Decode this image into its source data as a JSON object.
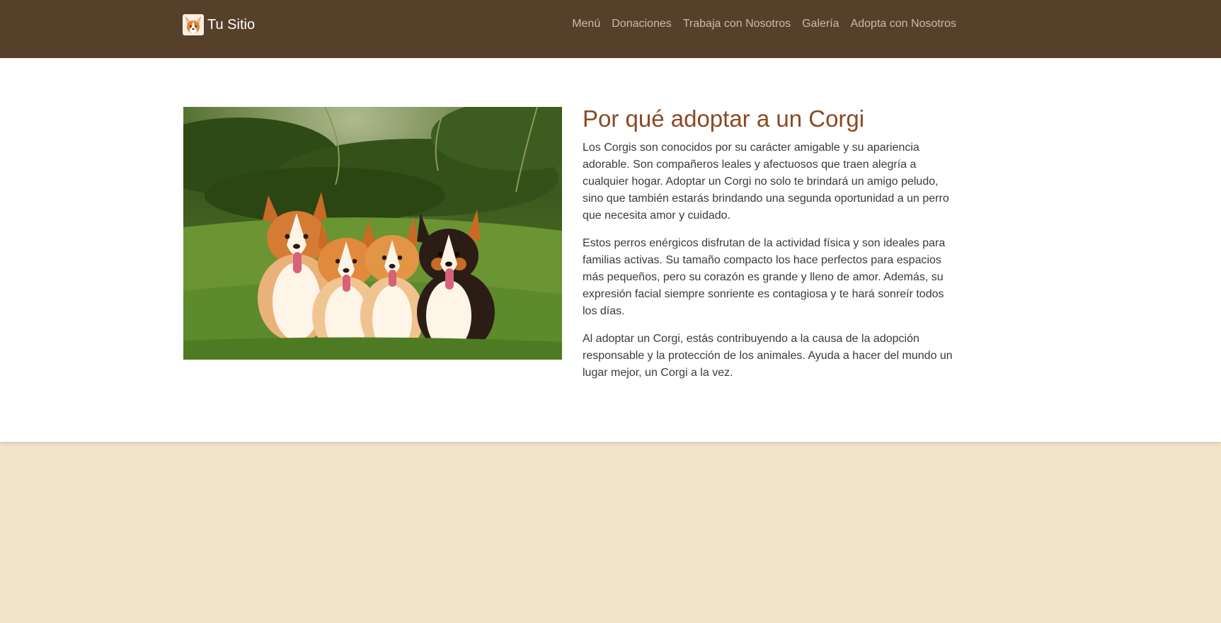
{
  "header": {
    "brand": "Tu Sitio",
    "logo_icon": "corgi-logo-icon",
    "background": "#56402a",
    "nav": [
      {
        "label": "Menú"
      },
      {
        "label": "Donaciones"
      },
      {
        "label": "Trabaja con Nosotros"
      },
      {
        "label": "Galería"
      },
      {
        "label": "Adopta con Nosotros"
      }
    ]
  },
  "main": {
    "image": {
      "subject": "corgi-group-photo"
    },
    "title": "Por qué adoptar a un Corgi",
    "paragraphs": [
      "Los Corgis son conocidos por su carácter amigable y su apariencia adorable. Son compañeros leales y afectuosos que traen alegría a cualquier hogar. Adoptar un Corgi no solo te brindará un amigo peludo, sino que también estarás brindando una segunda oportunidad a un perro que necesita amor y cuidado.",
      "Estos perros enérgicos disfrutan de la actividad física y son ideales para familias activas. Su tamaño compacto los hace perfectos para espacios más pequeños, pero su corazón es grande y lleno de amor. Además, su expresión facial siempre sonriente es contagiosa y te hará sonreír todos los días.",
      "Al adoptar un Corgi, estás contribuyendo a la causa de la adopción responsable y la protección de los animales. Ayuda a hacer del mundo un lugar mejor, un Corgi a la vez."
    ]
  },
  "colors": {
    "accent_title": "#8b4a24",
    "page_background": "#f2e4c9"
  }
}
